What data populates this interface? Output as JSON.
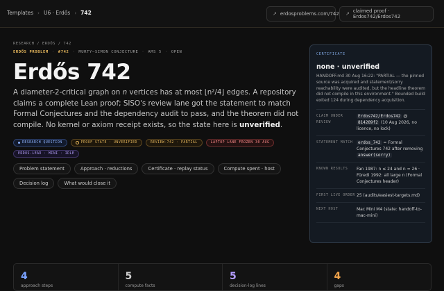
{
  "breadcrumb": {
    "root": "Templates",
    "mid": "U6 · Erdős",
    "current": "742"
  },
  "topbar": {
    "link_chip": "erdosproblems.com/742",
    "proof_chip": "claimed proof · Erdos742/Erdos742"
  },
  "header": {
    "path": "RESEARCH / ERDŐS / 742",
    "meta": [
      "ERDŐS PROBLEM",
      "#742",
      "MURTY–SIMON CONJECTURE",
      "AMS 5",
      "OPEN"
    ],
    "title": "Erdős 742",
    "desc_1": "A diameter-2-critical graph on ",
    "desc_n": "n",
    "desc_2": " vertices has at most ⌊n²/4⌋ edges. A repository claims a complete Lean proof; SISO's review lane got the statement to match Formal Conjectures and the dependency audit to pass, and the theorem did not compile. No kernel or axiom receipt exists, so the state here is ",
    "desc_strong": "unverified",
    "desc_end": "."
  },
  "badges": [
    {
      "label": "RESEARCH QUESTION",
      "tone": "blue"
    },
    {
      "label": "PROOF STATE · UNVERIFIED",
      "tone": "amber"
    },
    {
      "label": "REVIEW-742 · PARTIAL",
      "tone": "amber"
    },
    {
      "label": "LAPTOP LANE FROZEN 30 AUG",
      "tone": "red"
    },
    {
      "label": "ERDOS-LEAD · MINI · IDLE",
      "tone": "purple"
    }
  ],
  "pills": [
    "Problem statement",
    "Approach · reductions",
    "Certificate · replay status",
    "Compute spent · host",
    "Decision log",
    "What would close it"
  ],
  "certificate": {
    "label": "CERTIFICATE",
    "status": "none · unverified",
    "note": "HANDOFF.md 30 Aug 16:22: \"PARTIAL — the pinned source was acquired and statement/sorry reachability were audited, but the headline theorem did not compile in this environment.\" Bounded build exited 124 during dependency acquisition.",
    "rows": [
      {
        "key": "CLAIM UNDER REVIEW",
        "code1": "Erdos742/Erdos742",
        "mid": " @ ",
        "code2": "814289f2",
        "rest": " (10 Aug 2026, no licence, no lock)"
      },
      {
        "key": "STATEMENT MATCH",
        "code1": "erdos_742",
        "mid": " = Formal Conjectures 742 after removing ",
        "code2": "answer(sorry)",
        "rest": ""
      },
      {
        "key": "KNOWN RESULTS",
        "code1": "",
        "mid": "Fan 1987: n ≤ 24 and n = 26 · Füredi 1992: all large n (Formal Conjectures header)",
        "code2": "",
        "rest": ""
      },
      {
        "key": "FIRST LIVE ORDER",
        "code1": "",
        "mid": "25 (audits/easiest-targets.md)",
        "code2": "",
        "rest": ""
      },
      {
        "key": "NEXT HOST",
        "code1": "",
        "mid": "Mac Mini M4 (state: handoff-to-mac-mini)",
        "code2": "",
        "rest": ""
      }
    ]
  },
  "stats": [
    {
      "num": "4",
      "cap": "approach steps",
      "color": "#7aa2ff"
    },
    {
      "num": "5",
      "cap": "compute facts",
      "color": "#cfcfcf"
    },
    {
      "num": "5",
      "cap": "decision-log lines",
      "color": "#b39cff"
    },
    {
      "num": "4",
      "cap": "gaps",
      "color": "#f0a24a"
    }
  ]
}
